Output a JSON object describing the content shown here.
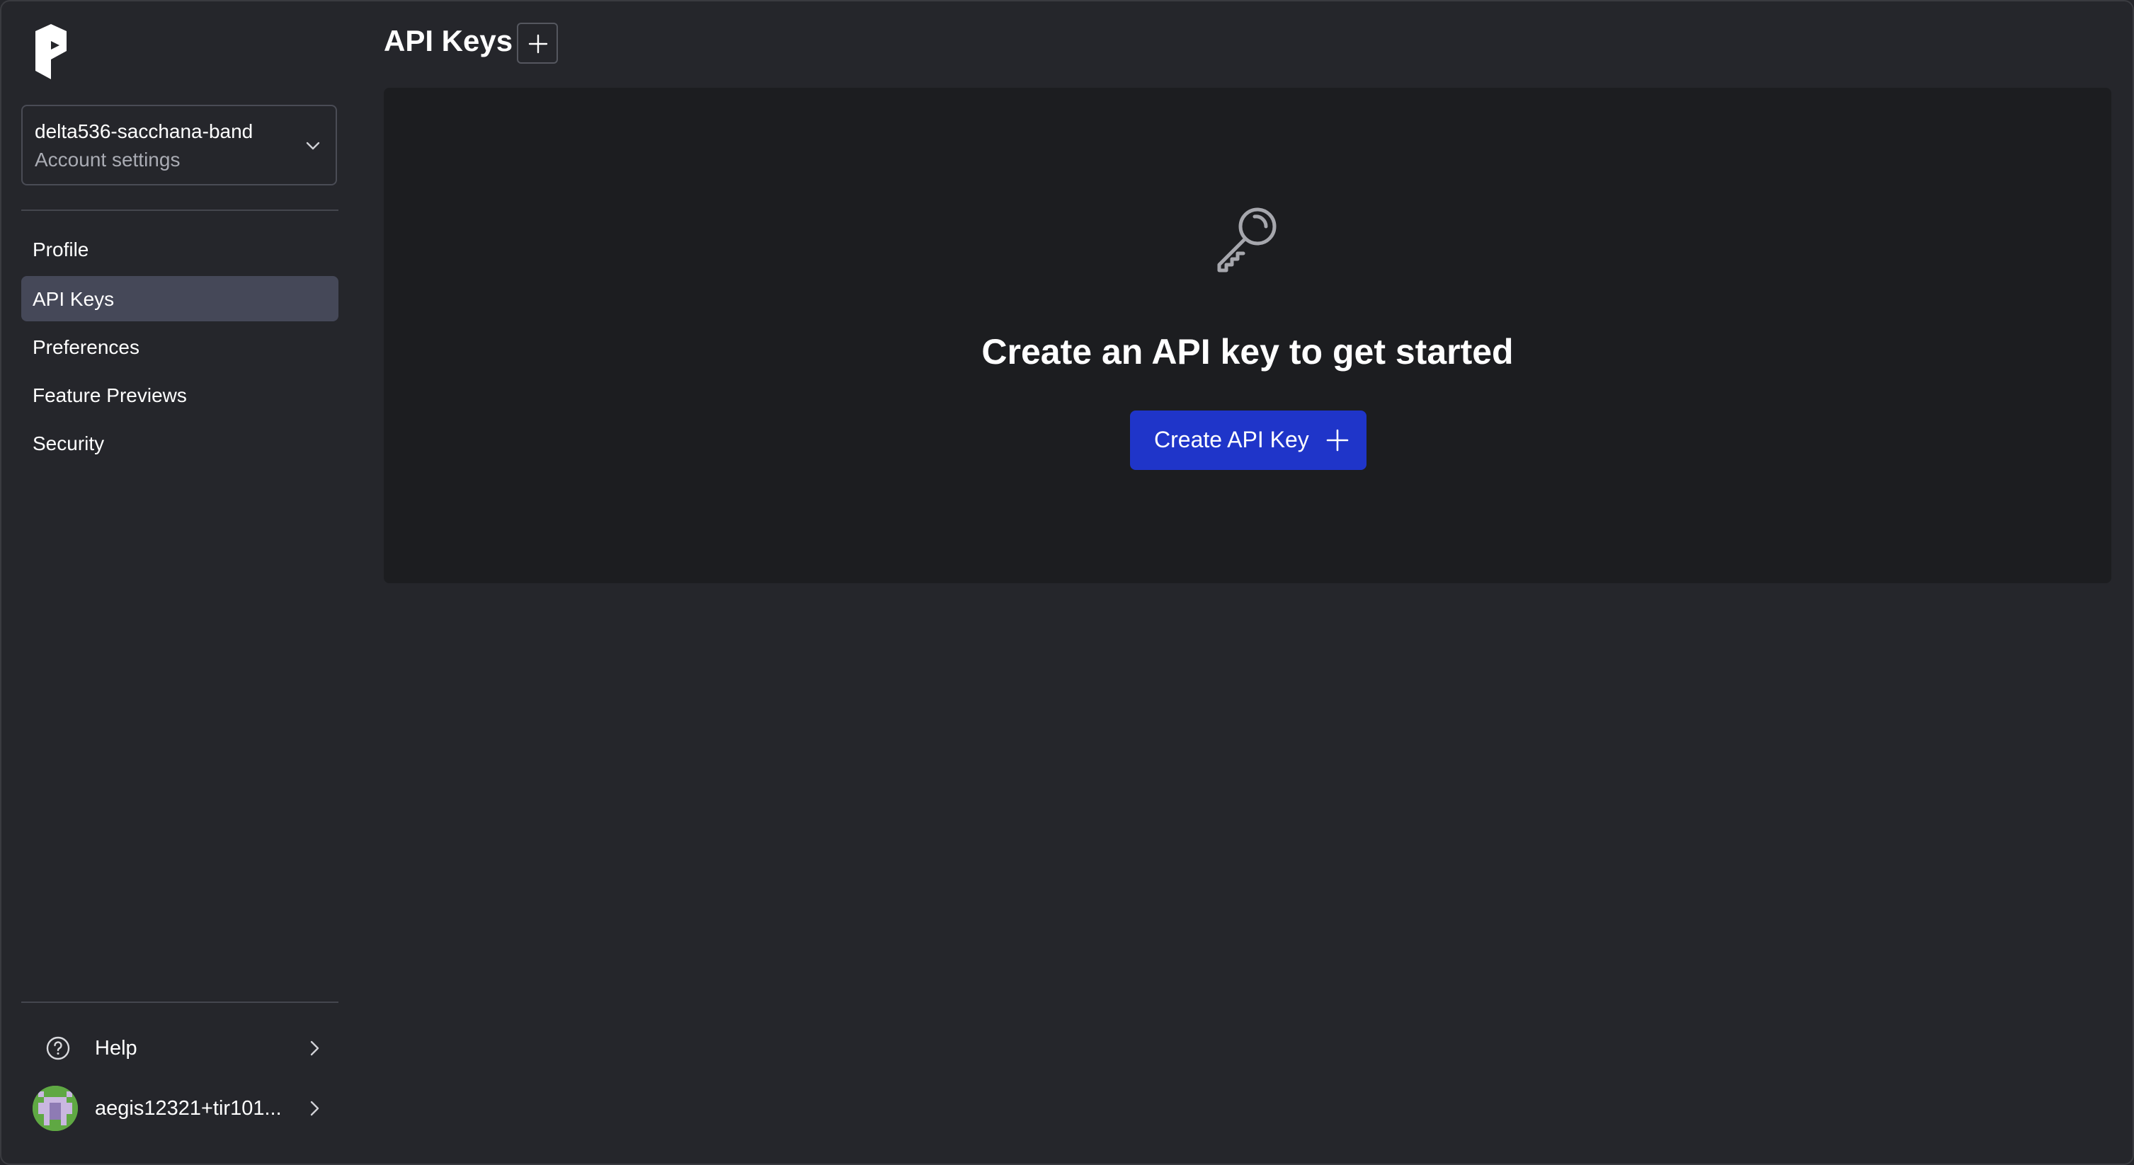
{
  "sidebar": {
    "logo_icon": "prefect-logo-icon",
    "workspace": {
      "name": "delta536-sacchana-band",
      "subtitle": "Account settings",
      "chevron_icon": "chevron-down-icon"
    },
    "items": [
      {
        "label": "Profile",
        "active": false
      },
      {
        "label": "API Keys",
        "active": true
      },
      {
        "label": "Preferences",
        "active": false
      },
      {
        "label": "Feature Previews",
        "active": false
      },
      {
        "label": "Security",
        "active": false
      }
    ],
    "help": {
      "label": "Help",
      "icon": "help-circle-icon"
    },
    "user": {
      "label": "aegis12321+tir101...",
      "icon": "avatar"
    }
  },
  "main": {
    "title": "API Keys",
    "title_add_icon": "plus-icon",
    "empty_state": {
      "icon": "key-icon",
      "heading": "Create an API key to get started",
      "button_label": "Create API Key",
      "button_icon": "plus-icon"
    }
  },
  "colors": {
    "background": "#25262b",
    "card": "#1c1d20",
    "active_nav": "#454858",
    "primary_button": "#1f35c9"
  }
}
